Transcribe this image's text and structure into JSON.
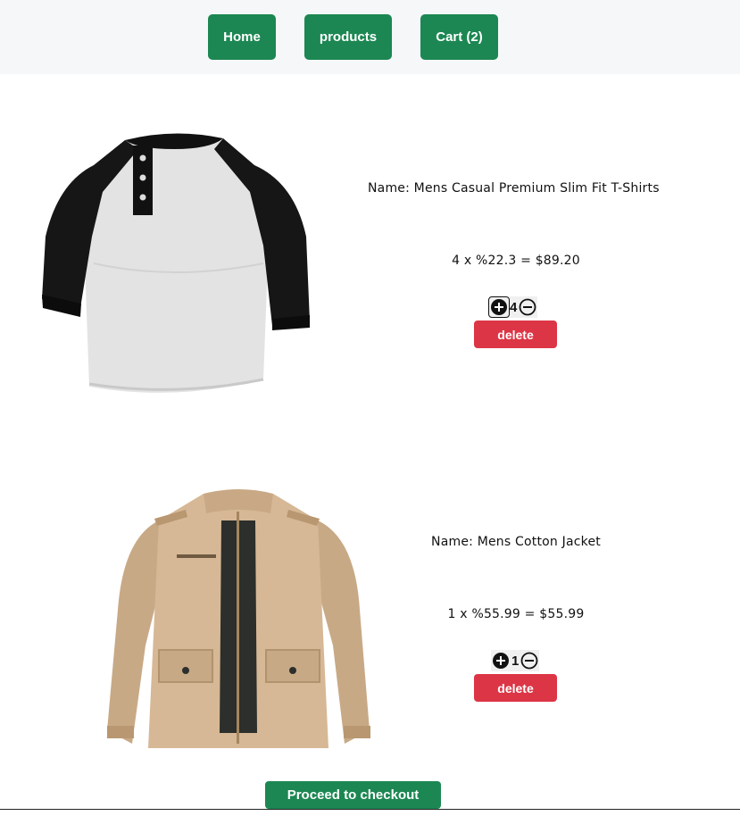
{
  "nav": {
    "home_label": "Home",
    "products_label": "products",
    "cart_label": "Cart (2)"
  },
  "colors": {
    "primary": "#1c8752",
    "danger": "#dc3545",
    "nav_bg": "#f6f7f9"
  },
  "cart": {
    "items": [
      {
        "name_label": "Name: Mens Casual Premium Slim Fit T-Shirts",
        "price_line": "4 x %22.3 = $89.20",
        "quantity": "4",
        "delete_label": "delete",
        "image_icon": "raglan-henley-shirt-image"
      },
      {
        "name_label": "Name: Mens Cotton Jacket",
        "price_line": "1 x %55.99 = $55.99",
        "quantity": "1",
        "delete_label": "delete",
        "image_icon": "cotton-jacket-image"
      }
    ],
    "checkout_label": "Proceed to checkout"
  }
}
